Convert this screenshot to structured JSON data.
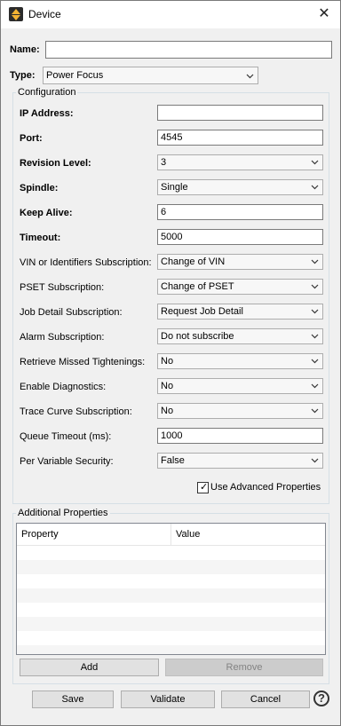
{
  "window": {
    "title": "Device",
    "close_glyph": "✕"
  },
  "device": {
    "name_label": "Name:",
    "name_value": "",
    "type_label": "Type:",
    "type_value": "Power Focus"
  },
  "configuration": {
    "legend": "Configuration",
    "rows": [
      {
        "label": "IP Address:",
        "bold": true,
        "kind": "input",
        "value": ""
      },
      {
        "label": "Port:",
        "bold": true,
        "kind": "input",
        "value": "4545"
      },
      {
        "label": "Revision Level:",
        "bold": true,
        "kind": "select",
        "value": "3"
      },
      {
        "label": "Spindle:",
        "bold": true,
        "kind": "select",
        "value": "Single"
      },
      {
        "label": "Keep Alive:",
        "bold": true,
        "kind": "input",
        "value": "6"
      },
      {
        "label": "Timeout:",
        "bold": true,
        "kind": "input",
        "value": "5000"
      },
      {
        "label": "VIN or Identifiers Subscription:",
        "bold": false,
        "kind": "select",
        "value": "Change of VIN"
      },
      {
        "label": "PSET Subscription:",
        "bold": false,
        "kind": "select",
        "value": "Change of PSET"
      },
      {
        "label": "Job Detail Subscription:",
        "bold": false,
        "kind": "select",
        "value": "Request Job Detail"
      },
      {
        "label": "Alarm Subscription:",
        "bold": false,
        "kind": "select",
        "value": "Do not subscribe"
      },
      {
        "label": "Retrieve Missed Tightenings:",
        "bold": false,
        "kind": "select",
        "value": "No"
      },
      {
        "label": "Enable Diagnostics:",
        "bold": false,
        "kind": "select",
        "value": "No"
      },
      {
        "label": "Trace Curve Subscription:",
        "bold": false,
        "kind": "select",
        "value": "No"
      },
      {
        "label": "Queue Timeout (ms):",
        "bold": false,
        "kind": "input",
        "value": "1000"
      },
      {
        "label": "Per Variable Security:",
        "bold": false,
        "kind": "select",
        "value": "False"
      }
    ],
    "advanced_checkbox_label": "Use Advanced Properties",
    "advanced_checked": true
  },
  "additional": {
    "legend": "Additional Properties",
    "columns": [
      "Property",
      "Value"
    ],
    "add_label": "Add",
    "remove_label": "Remove"
  },
  "footer": {
    "save_label": "Save",
    "validate_label": "Validate",
    "cancel_label": "Cancel",
    "help_glyph": "?"
  }
}
